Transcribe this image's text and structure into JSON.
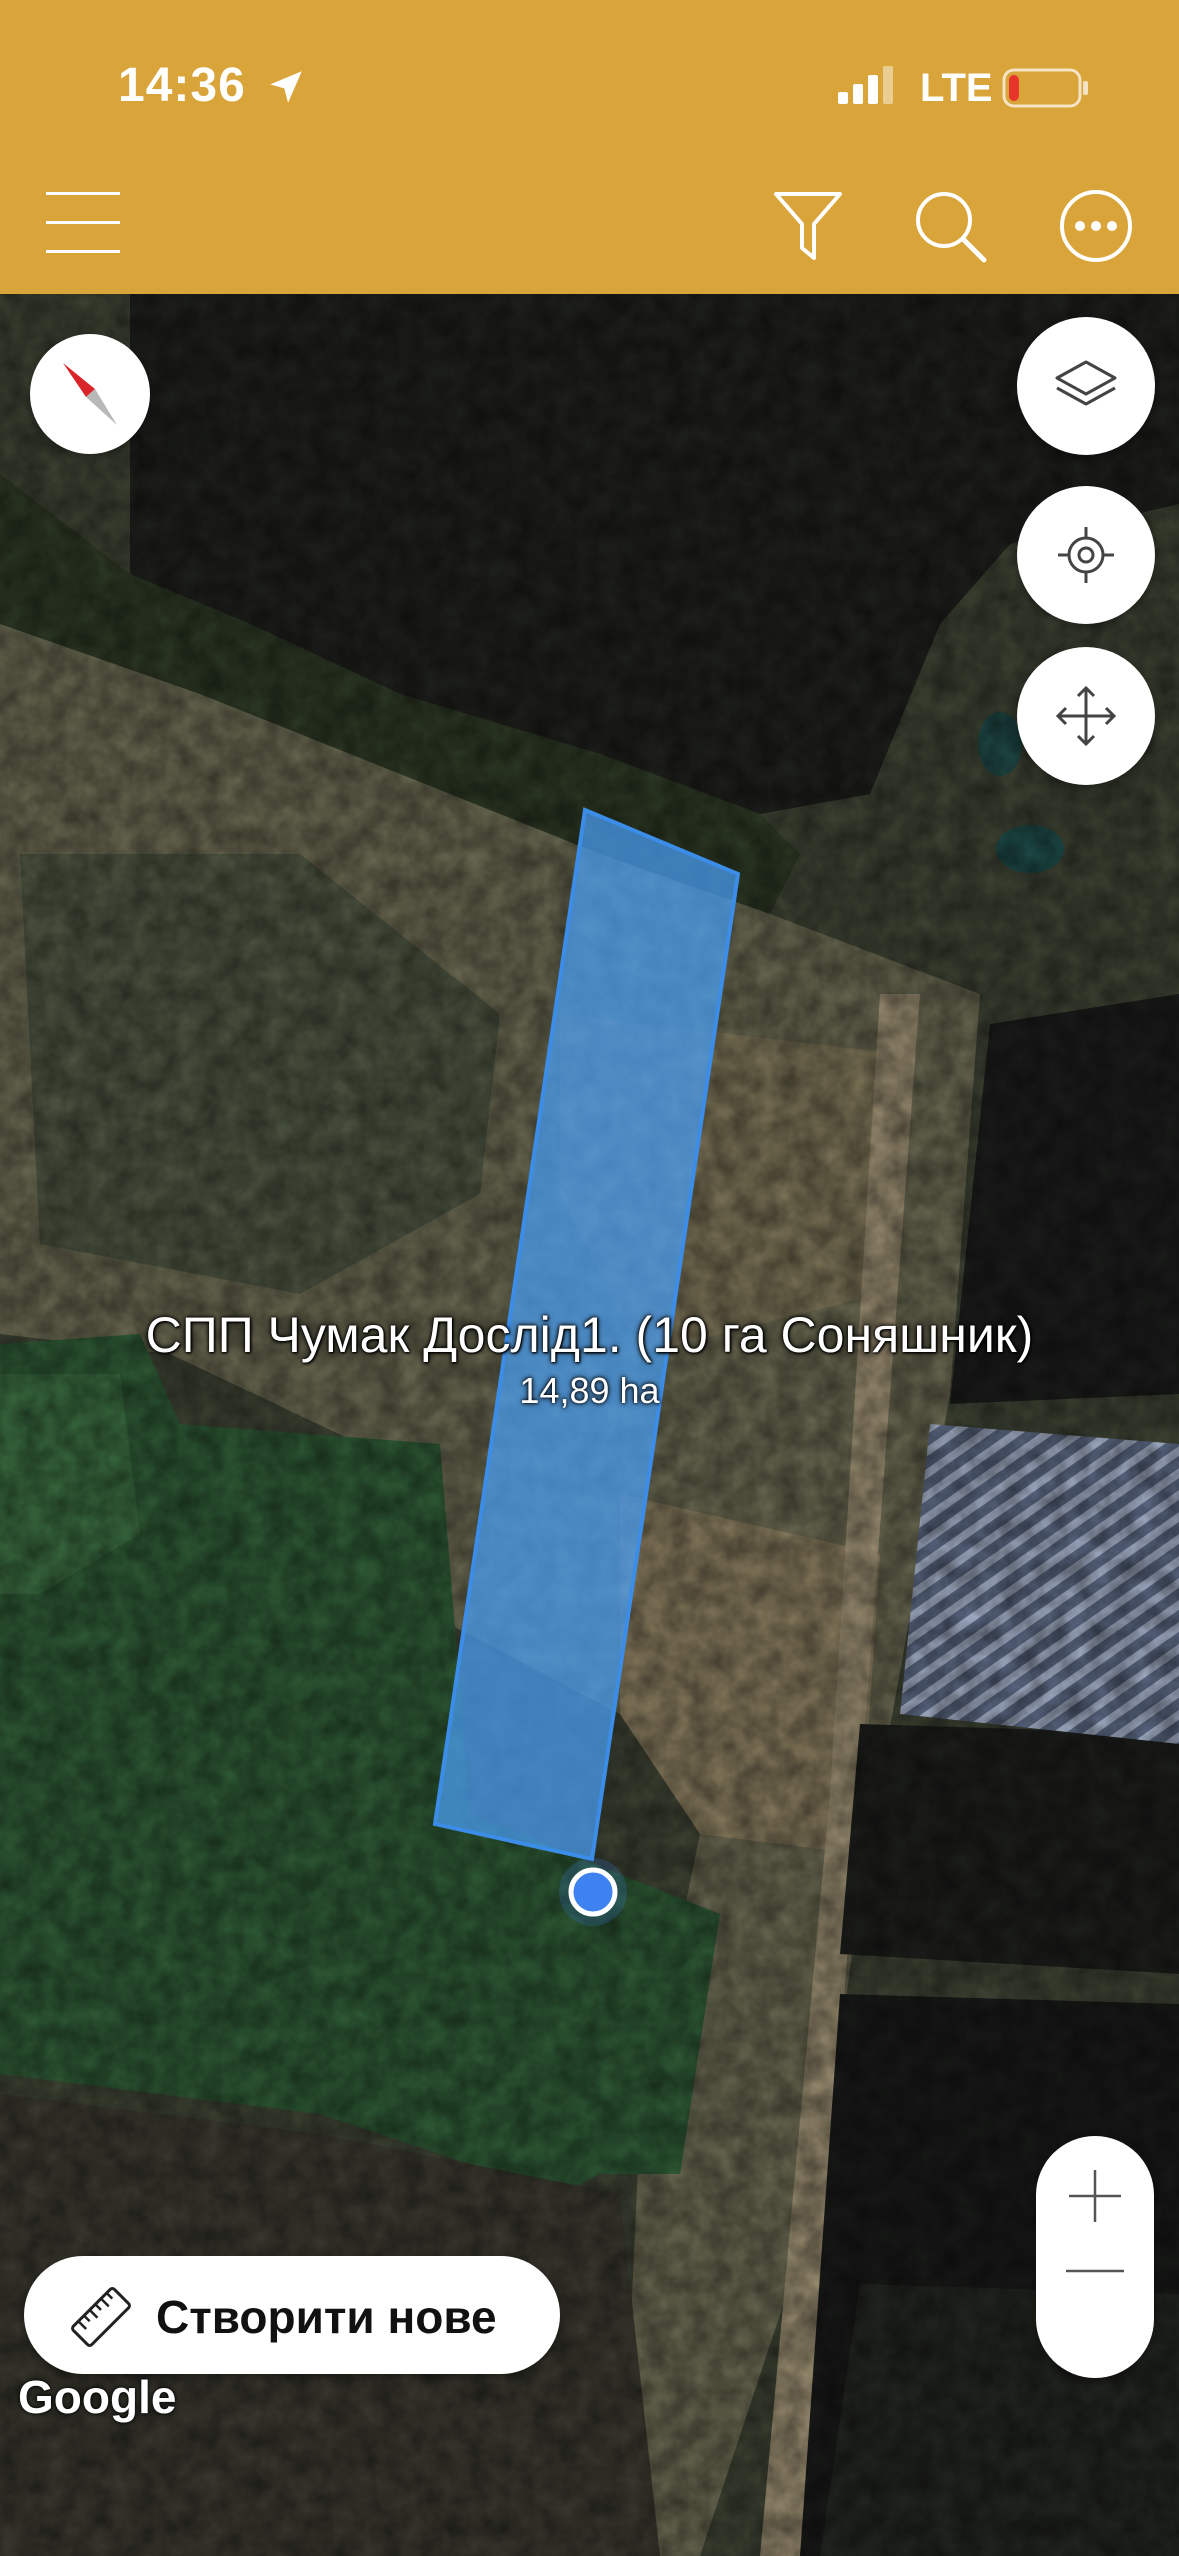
{
  "status_bar": {
    "time": "14:36",
    "network": "LTE",
    "battery_level": 0.15,
    "icons": [
      "location-arrow-icon",
      "signal-bars-icon",
      "battery-low-icon"
    ]
  },
  "toolbar": {
    "icons": [
      "hamburger-menu-icon",
      "filter-icon",
      "search-icon",
      "more-options-icon"
    ]
  },
  "map": {
    "controls": [
      "compass-icon",
      "layers-icon",
      "locate-icon",
      "pan-move-icon",
      "zoom-in-icon",
      "zoom-out-icon"
    ],
    "field": {
      "name": "СПП Чумак Дослід1. (10 га Соняшник)",
      "area": "14,89 ha"
    },
    "attribution": "Google"
  },
  "actions": {
    "create_label": "Створити нове",
    "create_icon": "ruler-icon"
  },
  "colors": {
    "header": "#d9a43a",
    "field_fill": "#4aa0f5",
    "field_stroke": "#3b8de8",
    "location_dot": "#3d82f0"
  }
}
